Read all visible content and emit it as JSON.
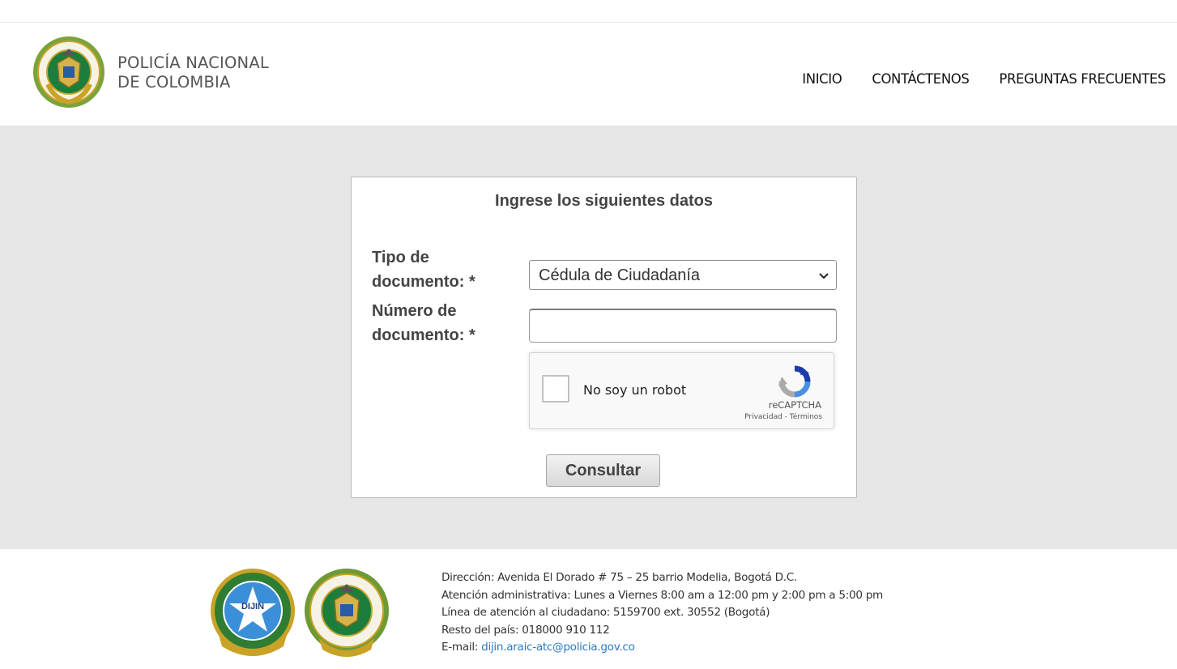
{
  "header": {
    "brand_line1": "POLICÍA NACIONAL",
    "brand_line2": "DE COLOMBIA",
    "logo_icon": "policia-nacional-emblem",
    "nav": [
      {
        "label": "INICIO"
      },
      {
        "label": "CONTÁCTENOS"
      },
      {
        "label": "PREGUNTAS FRECUENTES"
      }
    ]
  },
  "form": {
    "title": "Ingrese los siguientes datos",
    "tipo_label_l1": "Tipo de",
    "tipo_label_l2": "documento: *",
    "numero_label_l1": "Número de",
    "numero_label_l2": "documento: *",
    "tipo_selected": "Cédula de Ciudadanía",
    "numero_value": "",
    "submit_label": "Consultar"
  },
  "captcha": {
    "label": "No soy un robot",
    "brand": "reCAPTCHA",
    "privacy": "Privacidad",
    "separator": " - ",
    "terms": "Términos"
  },
  "footer": {
    "seal_dijin_text": "DIJIN",
    "address": "Dirección: Avenida El Dorado # 75 – 25 barrio Modelia, Bogotá D.C.",
    "hours": "Atención administrativa: Lunes a Viernes 8:00 am a 12:00 pm y 2:00 pm a 5:00 pm",
    "phone": "Línea de atención al ciudadano: 5159700 ext. 30552 (Bogotá)",
    "national": "Resto del país: 018000 910 112",
    "email_prefix": "E-mail: ",
    "email": "dijin.araic-atc@policia.gov.co"
  },
  "colors": {
    "band": "#e6e6e6",
    "link": "#2a79c2",
    "text": "#444444",
    "seal_green": "#2e7d32",
    "seal_gold": "#c9a227",
    "dijin_blue": "#3a8fd8"
  }
}
